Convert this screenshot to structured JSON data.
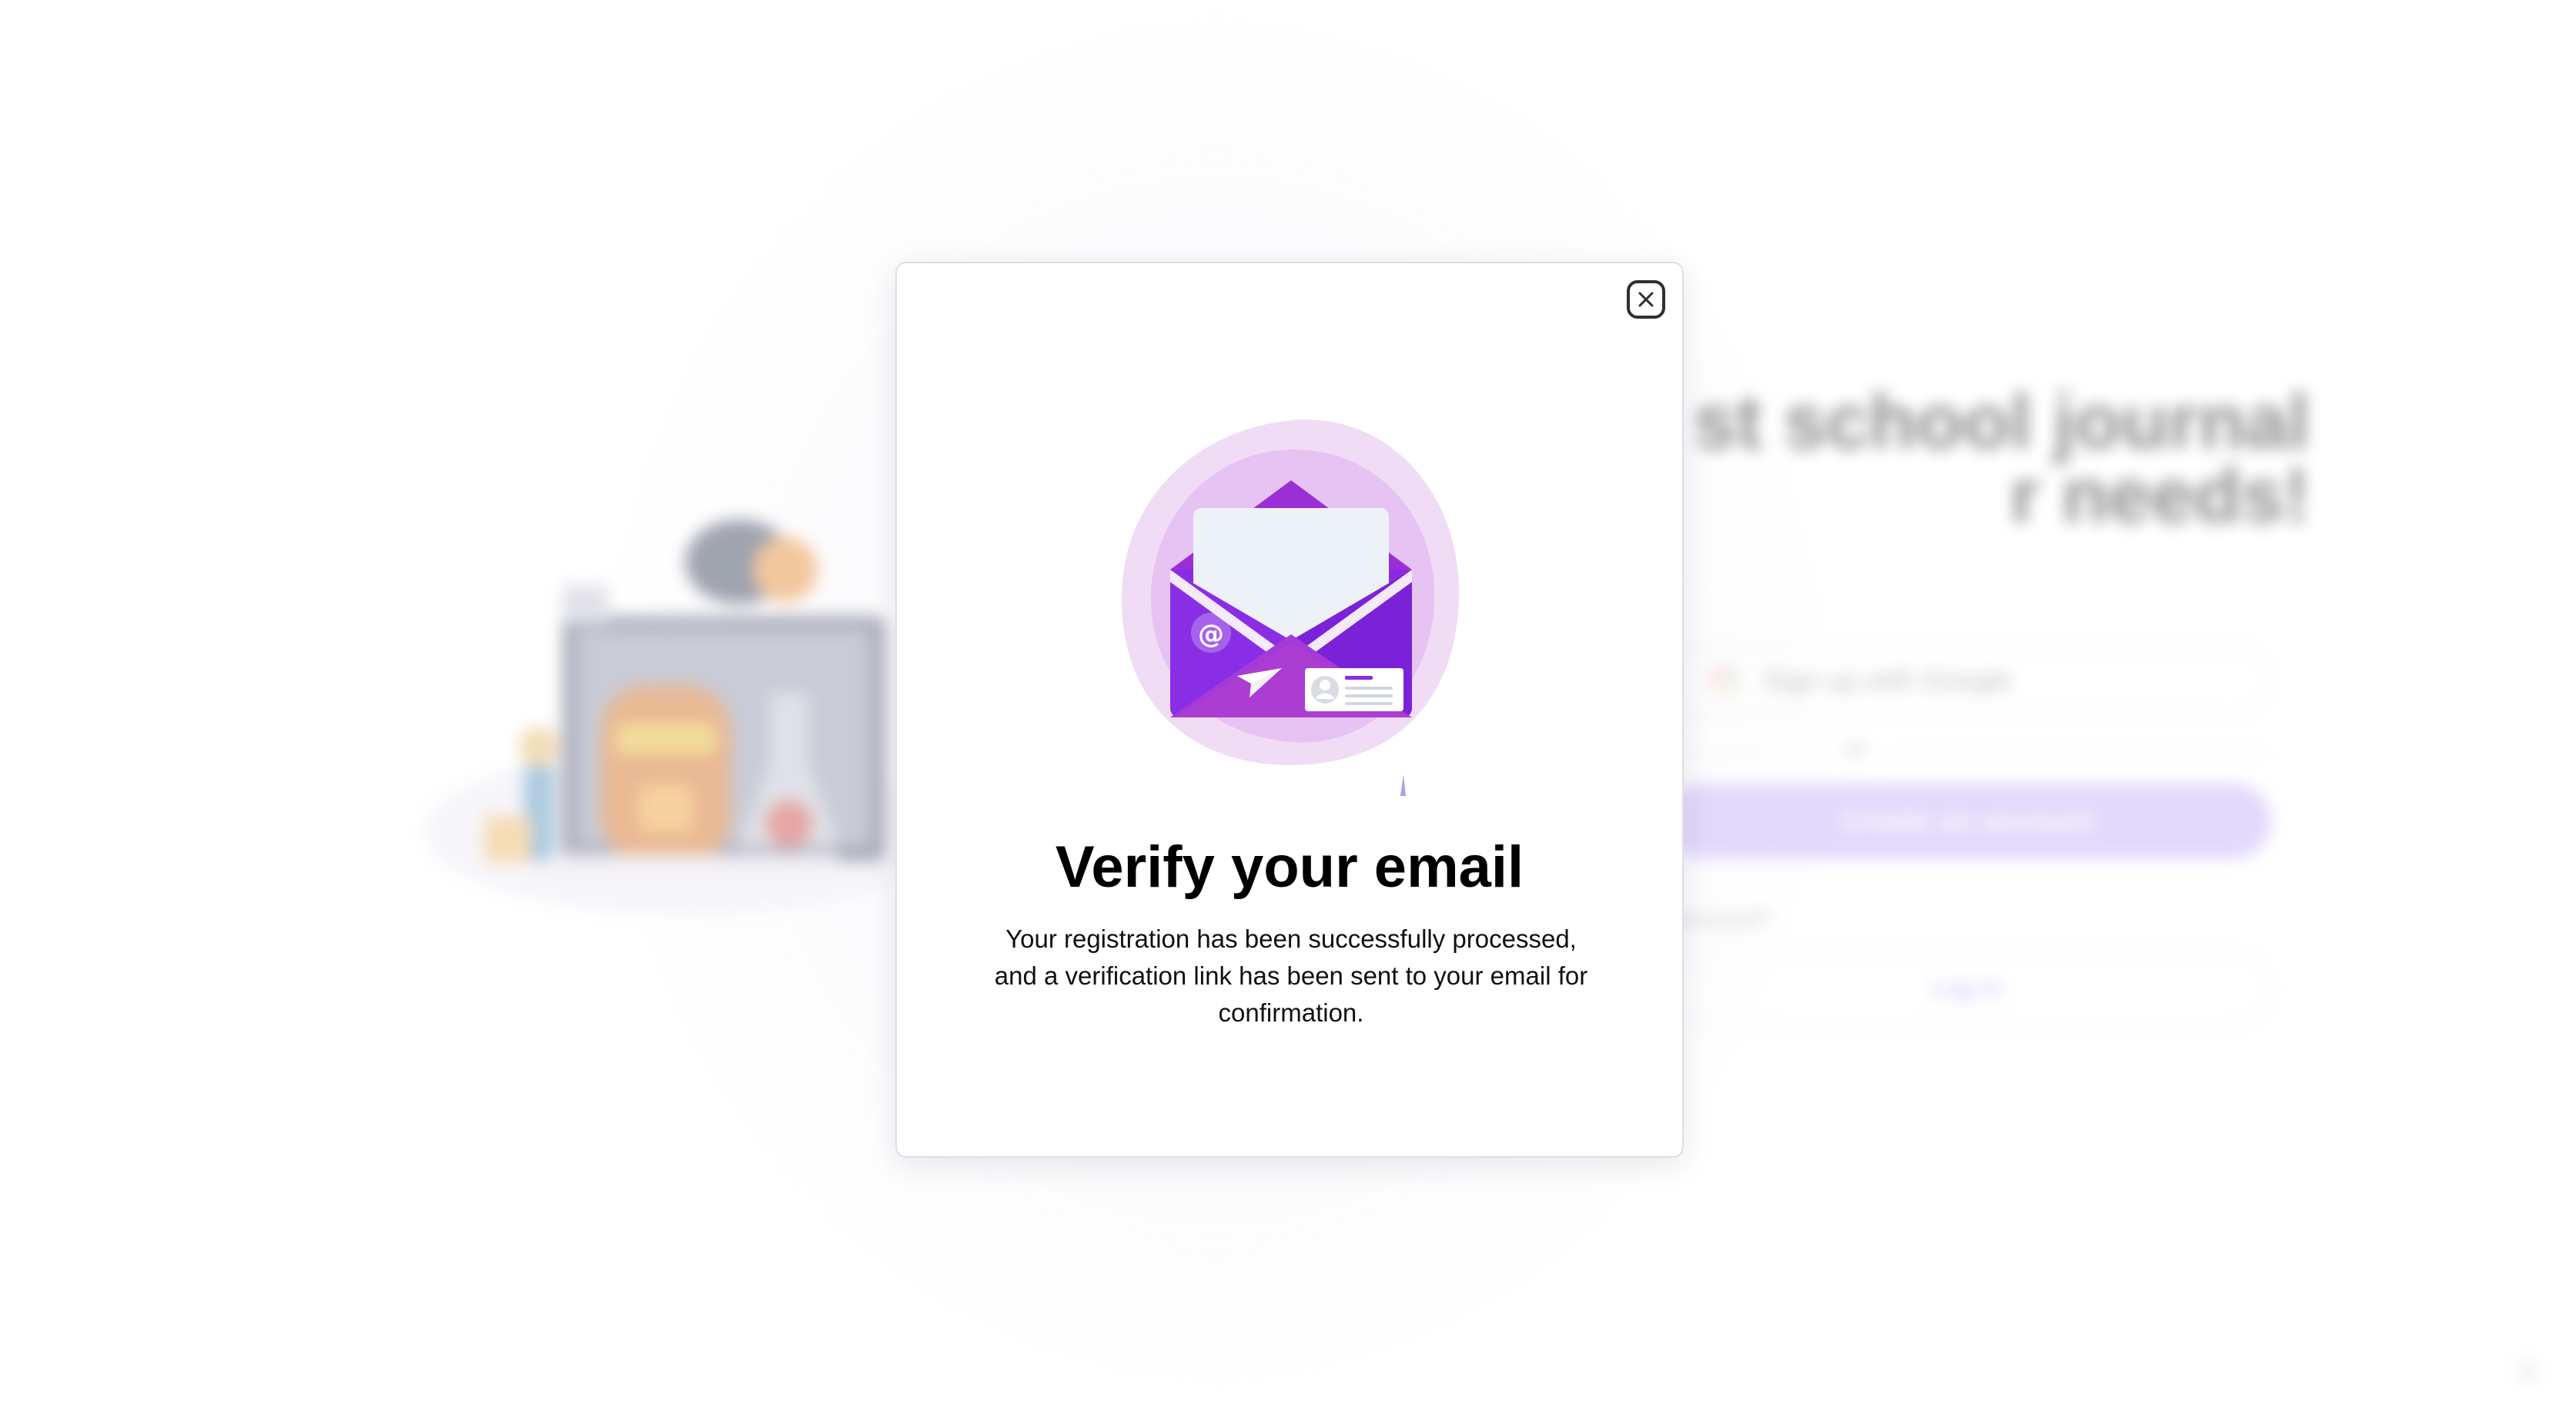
{
  "background": {
    "headline_line1": "st school journal",
    "headline_line2": "r needs!",
    "google_button_label": "Sign up with Google",
    "divider_label": "or",
    "create_account_label": "Create an account",
    "have_account_text": "r account?",
    "login_label": "Log in"
  },
  "modal": {
    "close_icon": "close-icon",
    "illustration_icon": "envelope-icon",
    "title": "Verify your email",
    "message": "Your registration has been successfully processed, and a verification link has been sent to your email for confirmation."
  },
  "colors": {
    "accent_purple": "#8a2be2",
    "blob_light": "#f1dcf6",
    "blob_mid": "#e6c3f2",
    "create_button_blurred": "#cbbaf8"
  }
}
